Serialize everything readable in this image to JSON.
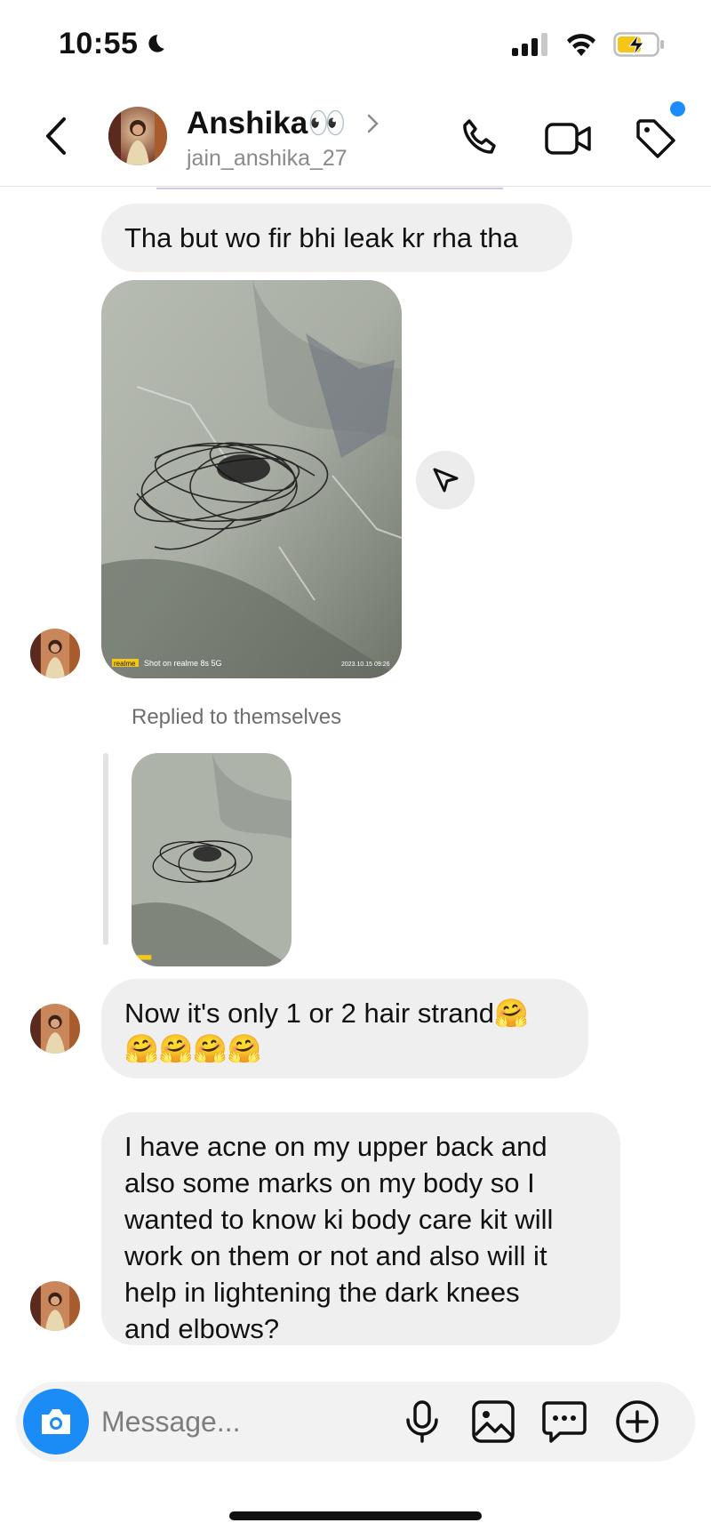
{
  "status": {
    "time": "10:55"
  },
  "header": {
    "name": "Anshika👀",
    "username": "jain_anshika_27"
  },
  "messages": {
    "m1": "Tha but wo fir bhi leak kr rha tha",
    "photo_watermark_brand": "realme",
    "photo_watermark_text": "Shot on realme 8s 5G",
    "photo_watermark_date": "2023.10.15 09:26",
    "replied_label": "Replied to themselves",
    "m2_line1": "Now it's only 1 or 2 hair strand🤗",
    "m2_line2": "🤗🤗🤗🤗",
    "m3": [
      "I have acne on my upper back  and",
      "also some marks on my body so I",
      "wanted to know ki body care kit will",
      "work on them or not and also will it",
      "help in lightening the dark knees",
      "and elbows?"
    ]
  },
  "composer": {
    "placeholder": "Message..."
  },
  "colors": {
    "accent": "#1b8cf5",
    "bubble": "#efefef",
    "notify": "#1a8cff",
    "battery": "#f5c518"
  }
}
